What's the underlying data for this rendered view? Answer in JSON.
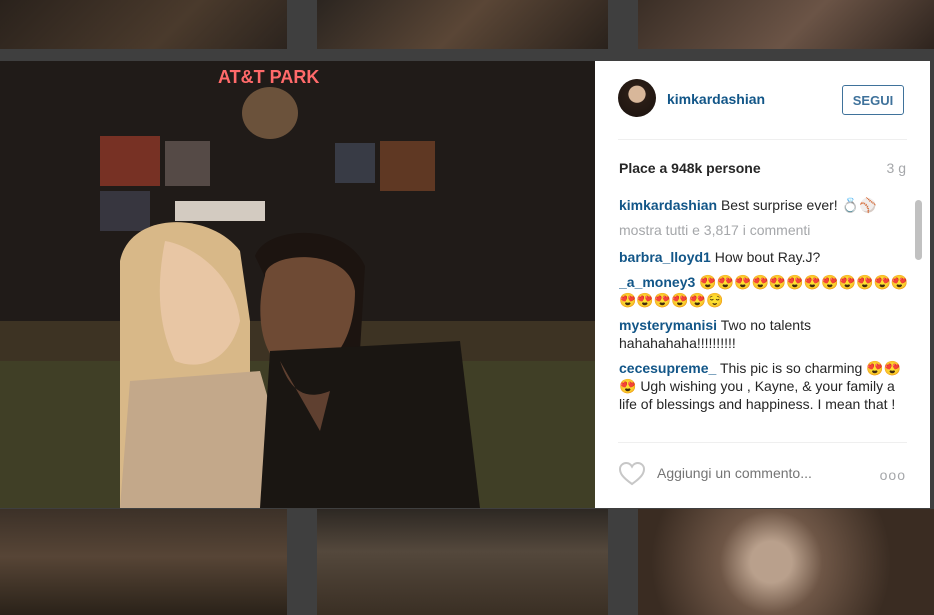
{
  "post": {
    "username": "kimkardashian",
    "follow_label": "SEGUI",
    "likes_text": "Place a 948k persone",
    "age": "3 g",
    "caption": "Best surprise ever! 💍⚾",
    "more_comments": "mostra tutti e 3,817 i commenti",
    "comments": [
      {
        "user": "barbra_lloyd1",
        "text": "How bout Ray.J?"
      },
      {
        "user": "_a_money3",
        "text": "😍😍😍😍😍😍😍😍😍😍😍😍😍😍😍😍😍😌"
      },
      {
        "user": "mysterymanisi",
        "text": "Two no talents hahahahaha!!!!!!!!!!"
      },
      {
        "user": "cecesupreme_",
        "text": "This pic is so charming 😍😍😍 Ugh wishing you , Kayne, & your family a life of blessings and happiness. I mean that !"
      }
    ],
    "comment_placeholder": "Aggiungi un commento...",
    "more_icon": "ooo",
    "photo_sign_text": "AT&T PARK"
  },
  "colors": {
    "link": "#125688",
    "follow": "#3f729b",
    "muted": "#a5a7aa"
  }
}
